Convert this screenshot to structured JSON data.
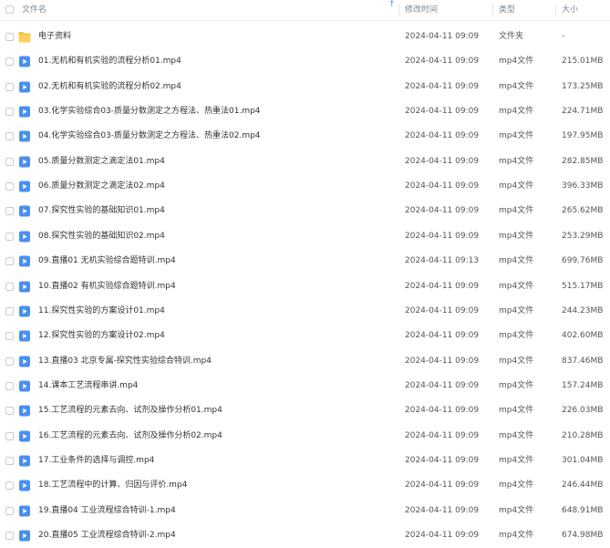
{
  "header": {
    "name": "文件名",
    "modified": "修改时间",
    "type": "类型",
    "size": "大小"
  },
  "colors": {
    "folder": "#f9c33b",
    "video": "#4a8ff0"
  },
  "rows": [
    {
      "name": "电子资料",
      "time": "2024-04-11 09:09",
      "type": "文件夹",
      "size": "-",
      "icon": "folder-icon"
    },
    {
      "name": "01.无机和有机实验的流程分析01.mp4",
      "time": "2024-04-11 09:09",
      "type": "mp4文件",
      "size": "215.01MB",
      "icon": "video-icon"
    },
    {
      "name": "02.无机和有机实验的流程分析02.mp4",
      "time": "2024-04-11 09:09",
      "type": "mp4文件",
      "size": "173.25MB",
      "icon": "video-icon"
    },
    {
      "name": "03.化学实验综合03-质量分数测定之方程法、热重法01.mp4",
      "time": "2024-04-11 09:09",
      "type": "mp4文件",
      "size": "224.71MB",
      "icon": "video-icon"
    },
    {
      "name": "04.化学实验综合03-质量分数测定之方程法、热重法02.mp4",
      "time": "2024-04-11 09:09",
      "type": "mp4文件",
      "size": "197.95MB",
      "icon": "video-icon"
    },
    {
      "name": "05.质量分数测定之滴定法01.mp4",
      "time": "2024-04-11 09:09",
      "type": "mp4文件",
      "size": "282.85MB",
      "icon": "video-icon"
    },
    {
      "name": "06.质量分数测定之滴定法02.mp4",
      "time": "2024-04-11 09:09",
      "type": "mp4文件",
      "size": "396.33MB",
      "icon": "video-icon"
    },
    {
      "name": "07.探究性实验的基础知识01.mp4",
      "time": "2024-04-11 09:09",
      "type": "mp4文件",
      "size": "265.62MB",
      "icon": "video-icon"
    },
    {
      "name": "08.探究性实验的基础知识02.mp4",
      "time": "2024-04-11 09:09",
      "type": "mp4文件",
      "size": "253.29MB",
      "icon": "video-icon"
    },
    {
      "name": "09.直播01 无机实验综合题特训.mp4",
      "time": "2024-04-11 09:13",
      "type": "mp4文件",
      "size": "699.76MB",
      "icon": "video-icon"
    },
    {
      "name": "10.直播02 有机实验综合题特训.mp4",
      "time": "2024-04-11 09:09",
      "type": "mp4文件",
      "size": "515.17MB",
      "icon": "video-icon"
    },
    {
      "name": "11.探究性实验的方案设计01.mp4",
      "time": "2024-04-11 09:09",
      "type": "mp4文件",
      "size": "244.23MB",
      "icon": "video-icon"
    },
    {
      "name": "12.探究性实验的方案设计02.mp4",
      "time": "2024-04-11 09:09",
      "type": "mp4文件",
      "size": "402.60MB",
      "icon": "video-icon"
    },
    {
      "name": "13.直播03 北京专属-探究性实验综合特训.mp4",
      "time": "2024-04-11 09:09",
      "type": "mp4文件",
      "size": "837.46MB",
      "icon": "video-icon"
    },
    {
      "name": "14.课本工艺流程串讲.mp4",
      "time": "2024-04-11 09:09",
      "type": "mp4文件",
      "size": "157.24MB",
      "icon": "video-icon"
    },
    {
      "name": "15.工艺流程的元素去向、试剂及操作分析01.mp4",
      "time": "2024-04-11 09:09",
      "type": "mp4文件",
      "size": "226.03MB",
      "icon": "video-icon"
    },
    {
      "name": "16.工艺流程的元素去向、试剂及操作分析02.mp4",
      "time": "2024-04-11 09:09",
      "type": "mp4文件",
      "size": "210.28MB",
      "icon": "video-icon"
    },
    {
      "name": "17.工业条件的选择与调控.mp4",
      "time": "2024-04-11 09:09",
      "type": "mp4文件",
      "size": "301.04MB",
      "icon": "video-icon"
    },
    {
      "name": "18.工艺流程中的计算、归因与评价.mp4",
      "time": "2024-04-11 09:09",
      "type": "mp4文件",
      "size": "246.44MB",
      "icon": "video-icon"
    },
    {
      "name": "19.直播04 工业流程综合特训-1.mp4",
      "time": "2024-04-11 09:09",
      "type": "mp4文件",
      "size": "648.91MB",
      "icon": "video-icon"
    },
    {
      "name": "20.直播05 工业流程综合特训-2.mp4",
      "time": "2024-04-11 09:09",
      "type": "mp4文件",
      "size": "674.98MB",
      "icon": "video-icon"
    }
  ]
}
